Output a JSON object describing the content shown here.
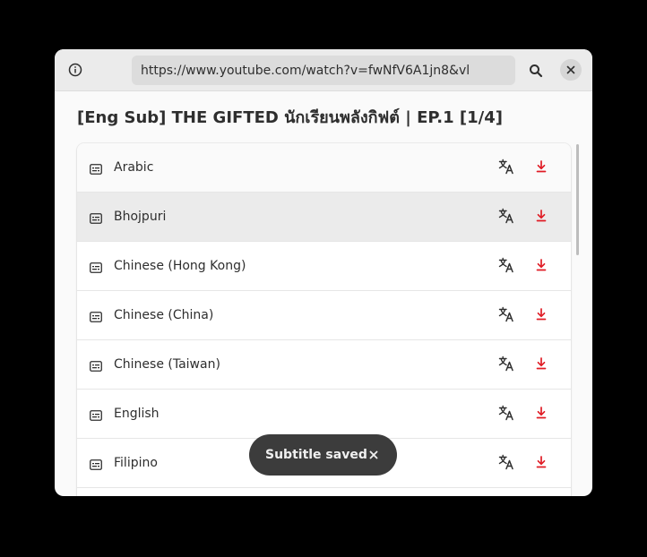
{
  "header": {
    "info_icon": "info-circle-icon",
    "url": "https://www.youtube.com/watch?v=fwNfV6A1jn8&vl",
    "search_icon": "search-icon",
    "close_icon": "close-icon"
  },
  "video": {
    "title": "[Eng Sub] THE GIFTED นักเรียนพลังกิฟต์ | EP.1 [1/4]"
  },
  "subtitles": [
    {
      "label": "Arabic"
    },
    {
      "label": "Bhojpuri"
    },
    {
      "label": "Chinese (Hong Kong)"
    },
    {
      "label": "Chinese (China)"
    },
    {
      "label": "Chinese (Taiwan)"
    },
    {
      "label": "English"
    },
    {
      "label": "Filipino"
    },
    {
      "label": ""
    }
  ],
  "row_icons": {
    "subtitle": "subtitles-icon",
    "translate": "translate-icon",
    "download": "download-icon"
  },
  "toast": {
    "label": "Subtitle saved",
    "close_icon": "close-icon"
  },
  "colors": {
    "accent_red": "#e01b24",
    "icon_gray": "#2e2e2e",
    "headerbar_bg": "#ebebeb",
    "hover_row_bg": "#ebebeb",
    "toast_bg": "#3c3c3c"
  }
}
